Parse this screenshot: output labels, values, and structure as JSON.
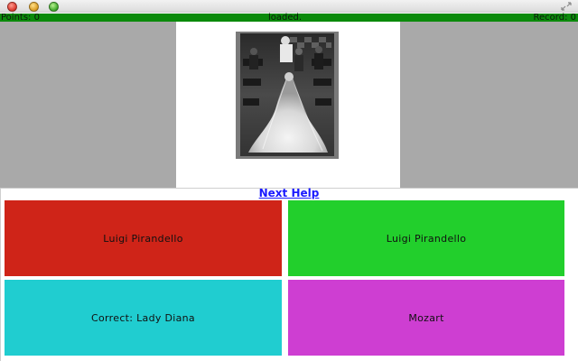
{
  "status": {
    "points": "Points: 0",
    "message": "loaded.",
    "record": "Record: 0"
  },
  "next_help": "Next Help",
  "answers": [
    {
      "label": "Luigi Pirandello",
      "color": "#cf2418"
    },
    {
      "label": "Luigi Pirandello",
      "color": "#22cf2c"
    },
    {
      "label": "Correct: Lady Diana",
      "color": "#20cdd0"
    },
    {
      "label": "Mozart",
      "color": "#ce3ed2"
    }
  ],
  "colors": {
    "status_bar": "#0b8a0b",
    "image_background": "#a9a9a9",
    "link": "#1a1aff"
  }
}
